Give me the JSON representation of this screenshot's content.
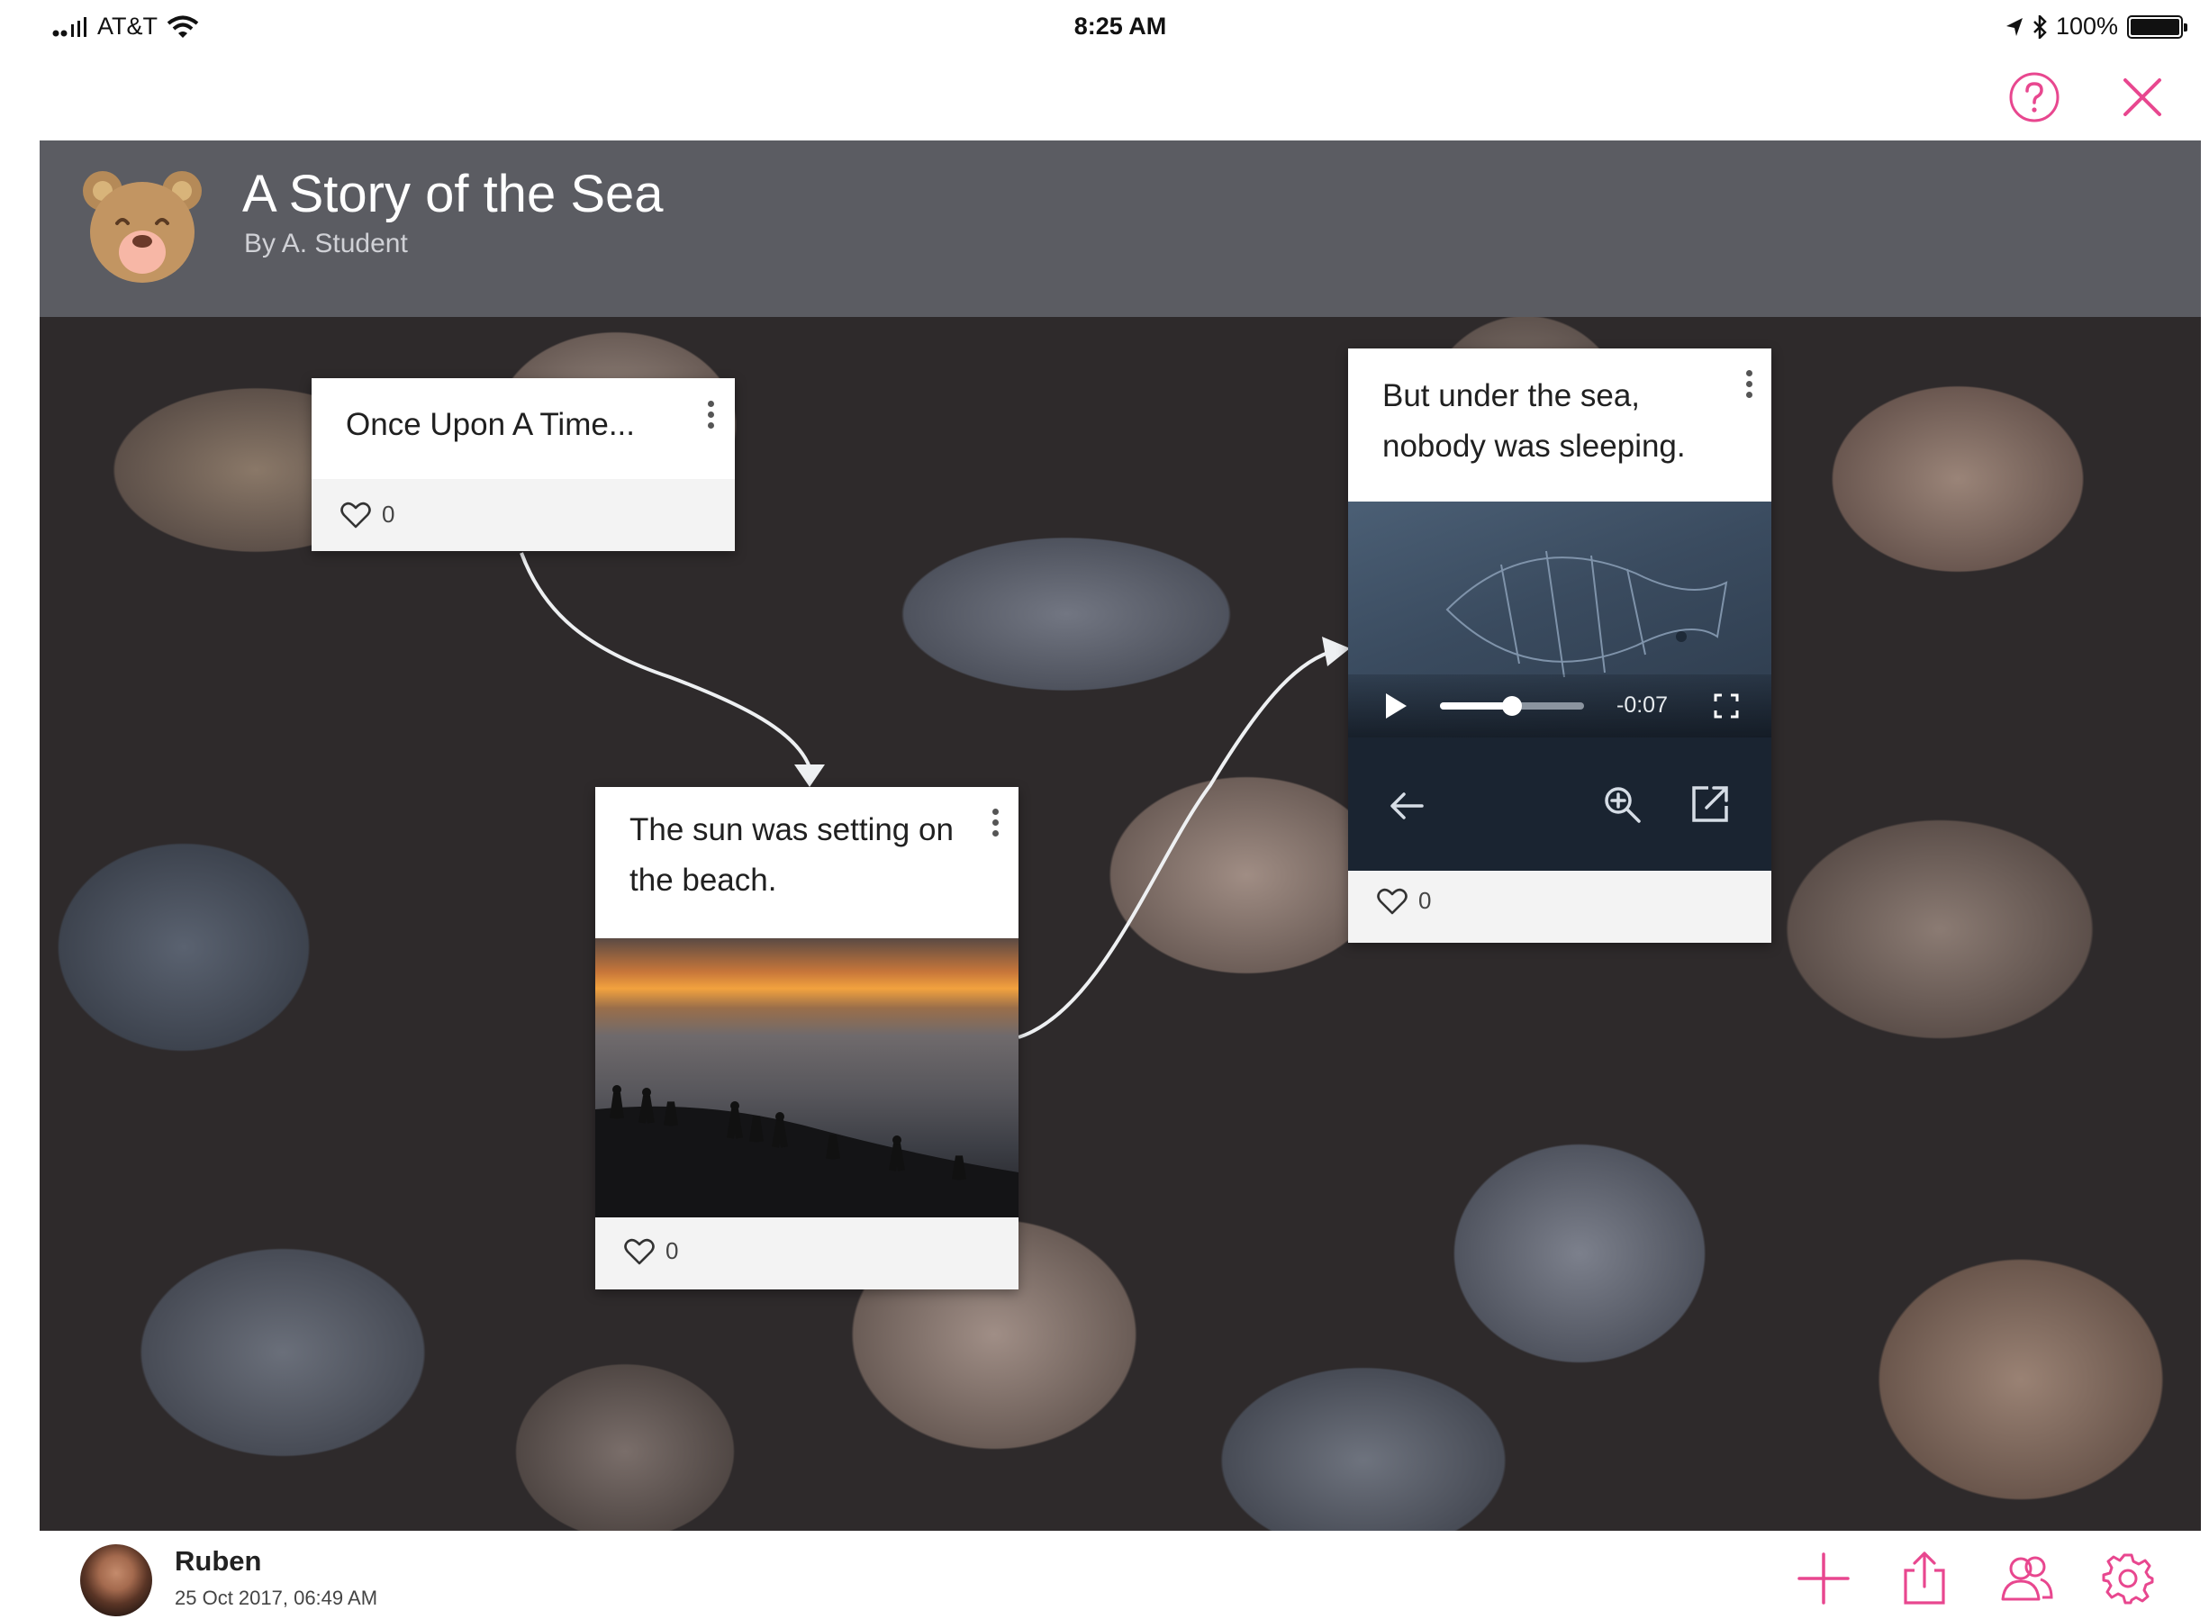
{
  "status_bar": {
    "carrier": "AT&T",
    "time": "8:25 AM",
    "battery": "100%",
    "battery_level": 1.0
  },
  "header": {
    "title": "A Story of the Sea",
    "byline": "By A. Student"
  },
  "posts": [
    {
      "text": "Once Upon A Time...",
      "likes": "0"
    },
    {
      "text": "The sun was setting on the beach.",
      "likes": "0"
    },
    {
      "text": "But under the sea, nobody was sleeping.",
      "likes": "0",
      "video": {
        "time_left": "-0:07",
        "progress": 0.5
      }
    }
  ],
  "user": {
    "name": "Ruben",
    "date": "25 Oct 2017, 06:49 AM"
  },
  "icons": {
    "nav": [
      "help-icon",
      "close-icon"
    ],
    "toolbar": [
      "plus-icon",
      "share-icon",
      "people-icon",
      "gear-icon"
    ],
    "viewer": [
      "back-arrow-icon",
      "zoom-in-icon",
      "open-external-icon"
    ]
  },
  "colors": {
    "accent": "#e8478f",
    "header_bg": "#5b5c62"
  }
}
